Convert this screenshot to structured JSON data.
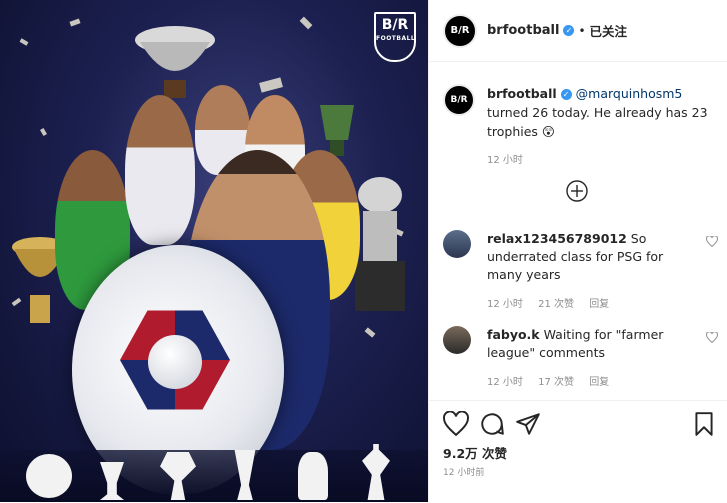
{
  "photo": {
    "logo_text": "B/R",
    "logo_sub": "FOOTBALL"
  },
  "header": {
    "avatar_text": "B/R",
    "username": "brfootball",
    "separator": "•",
    "follow_label": "已关注"
  },
  "caption": {
    "avatar_text": "B/R",
    "username": "brfootball",
    "mention": "@marquinhosm5",
    "text": " turned 26 today. He already has 23 trophies 😲",
    "time": "12 小时"
  },
  "comments": [
    {
      "username": "relax123456789012",
      "text": " So underrated class for PSG for many years",
      "time": "12 小时",
      "likes": "21 次赞",
      "reply": "回复"
    },
    {
      "username": "fabyo.k",
      "text": " Waiting for \"farmer league\" comments",
      "time": "12 小时",
      "likes": "17 次赞",
      "reply": "回复"
    }
  ],
  "footer": {
    "likes": "9.2万 次赞",
    "posted": "12 小时前"
  },
  "colors": {
    "verified": "#3897f0",
    "mention": "#00376b",
    "muted": "#8e8e8e"
  }
}
